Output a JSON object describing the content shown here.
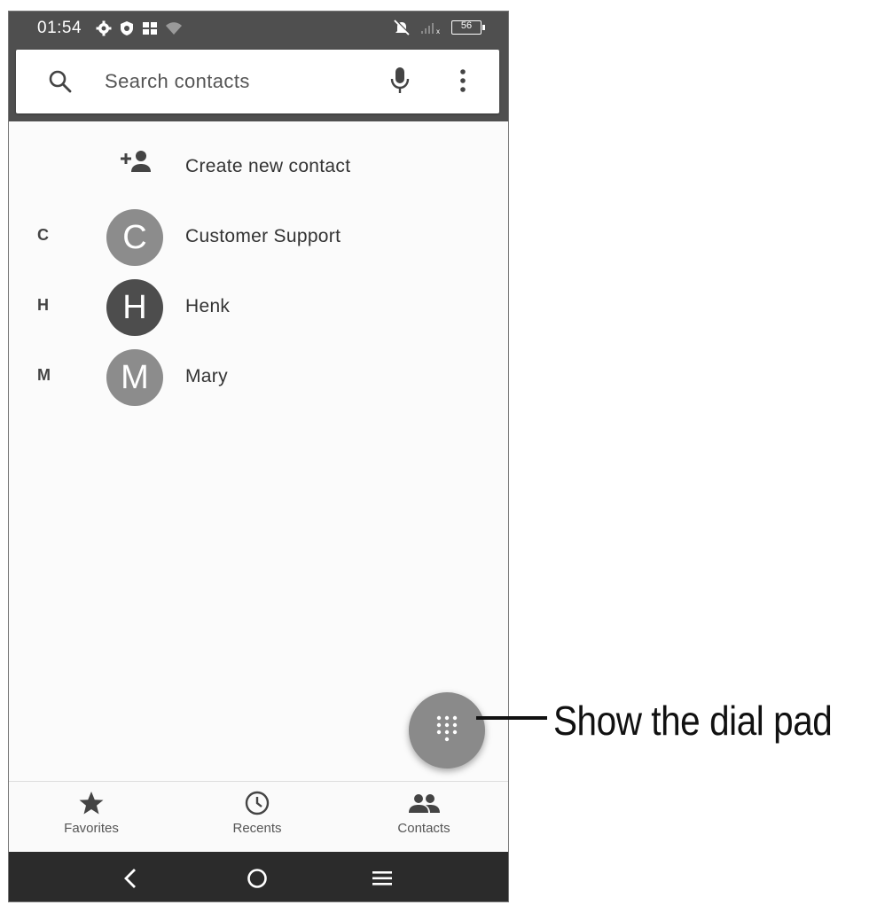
{
  "status_bar": {
    "time": "01:54",
    "battery": "56",
    "icons": [
      "settings-icon",
      "shield-icon",
      "grid-icon",
      "wifi-icon",
      "bell-off-icon",
      "signal-icon",
      "battery-icon"
    ]
  },
  "search": {
    "placeholder": "Search contacts",
    "icons": [
      "search-icon",
      "mic-icon",
      "more-vert-icon"
    ]
  },
  "create_contact": {
    "label": "Create new contact",
    "icon": "person-add-icon"
  },
  "contacts": [
    {
      "section": "C",
      "initial": "C",
      "name": "Customer Support",
      "avatar_color": "#8c8c8c"
    },
    {
      "section": "H",
      "initial": "H",
      "name": "Henk",
      "avatar_color": "#4d4d4d"
    },
    {
      "section": "M",
      "initial": "M",
      "name": "Mary",
      "avatar_color": "#8c8c8c"
    }
  ],
  "fab": {
    "icon": "dialpad-icon",
    "color": "#8a8a8a"
  },
  "bottom_nav": [
    {
      "label": "Favorites",
      "icon": "star-icon"
    },
    {
      "label": "Recents",
      "icon": "clock-icon"
    },
    {
      "label": "Contacts",
      "icon": "people-icon"
    }
  ],
  "system_nav": [
    "back-icon",
    "home-icon",
    "menu-icon"
  ],
  "callout": {
    "text": "Show the dial pad"
  }
}
